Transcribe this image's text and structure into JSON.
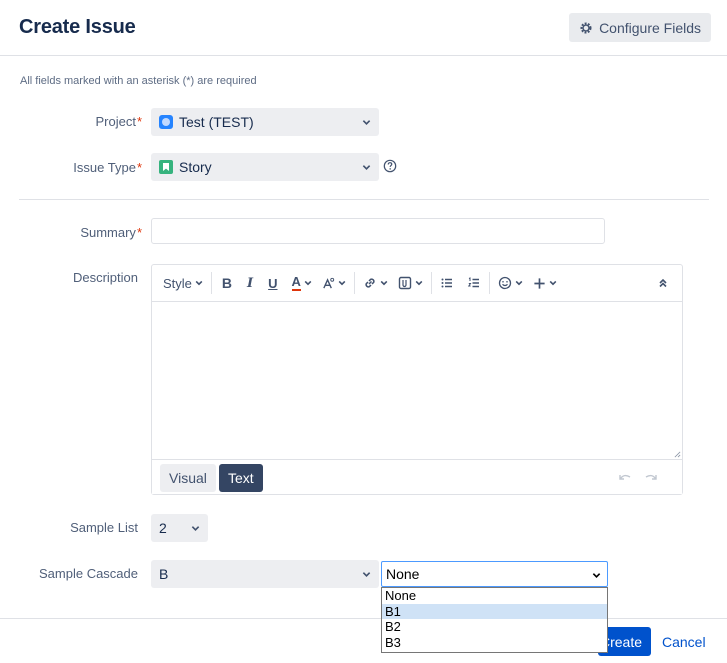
{
  "dialog": {
    "title": "Create Issue",
    "configure_fields_label": "Configure Fields",
    "required_note": "All fields marked with an asterisk (*) are required"
  },
  "fields": {
    "project": {
      "label": "Project",
      "value": "Test (TEST)"
    },
    "issue_type": {
      "label": "Issue Type",
      "value": "Story"
    },
    "summary": {
      "label": "Summary",
      "value": ""
    },
    "description": {
      "label": "Description",
      "toolbar": {
        "style_label": "Style",
        "bold": "B",
        "italic": "I",
        "underline": "U",
        "text_color": "A",
        "icons": [
          "chevron-down-icon",
          "text-effects-icon",
          "link-icon",
          "attachment-icon",
          "bullet-list-icon",
          "numbered-list-icon",
          "emoji-icon",
          "plus-icon",
          "collapse-icon"
        ]
      },
      "modes": {
        "visual": "Visual",
        "text": "Text",
        "active": "Text"
      }
    },
    "sample_list": {
      "label": "Sample List",
      "value": "2"
    },
    "sample_cascade": {
      "label": "Sample Cascade",
      "parent_value": "B",
      "child_value": "None",
      "child_options": [
        "None",
        "B1",
        "B2",
        "B3"
      ],
      "highlighted_option": "B1"
    }
  },
  "footer": {
    "create_label": "Create",
    "cancel_label": "Cancel"
  },
  "colors": {
    "primary": "#0052cc",
    "required_asterisk": "#de350b",
    "text_mode_active": "#344563"
  }
}
